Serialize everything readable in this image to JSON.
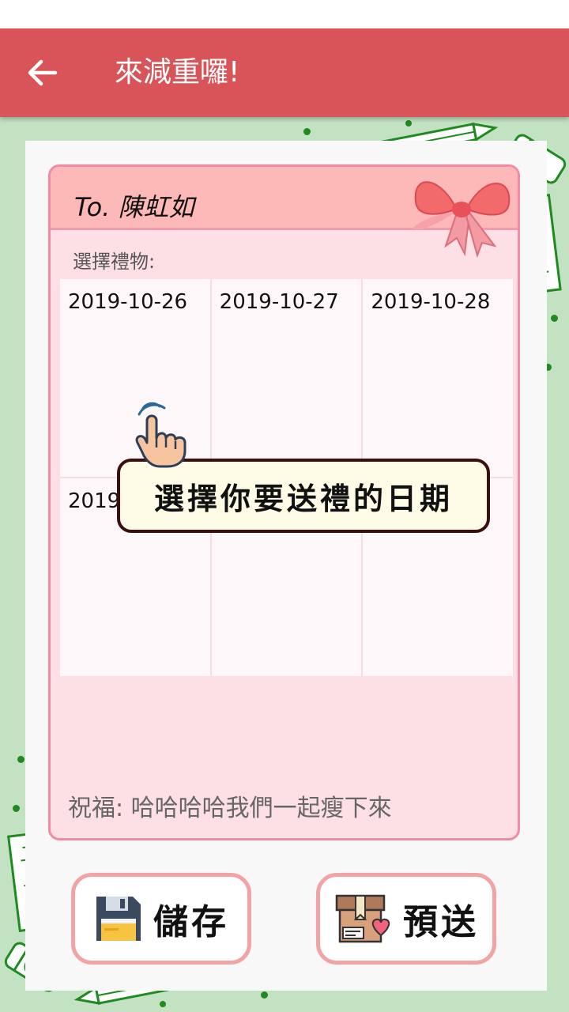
{
  "app_bar": {
    "title": "來減重囉!",
    "back_icon": "arrow-left-icon",
    "color": "#d95459"
  },
  "card": {
    "recipient": "To. 陳虹如",
    "gift_label": "選擇禮物:",
    "dates": [
      "2019-10-26",
      "2019-10-27",
      "2019-10-28",
      "2019",
      "",
      ""
    ],
    "blessing": "祝福: 哈哈哈哈我們一起瘦下來"
  },
  "tooltip": {
    "text": "選擇你要送禮的日期"
  },
  "buttons": {
    "save_label": "儲存",
    "save_icon": "floppy-disk-icon",
    "send_label": "預送",
    "send_icon": "gift-box-icon"
  },
  "colors": {
    "background": "#c3e2c1",
    "card_border": "#f08aa5",
    "card_header": "#fdb8b8",
    "card_fill": "#fde0e6",
    "button_border": "#f2a3a3"
  }
}
